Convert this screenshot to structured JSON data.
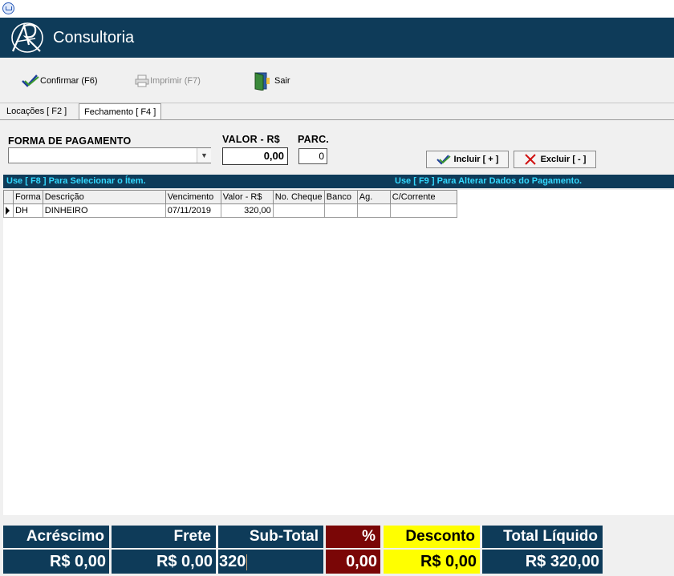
{
  "brand": {
    "name": "Consultoria"
  },
  "toolbar": {
    "confirm_label": "Confirmar (F6)",
    "print_label": "Imprimir  (F7)",
    "exit_label": "Sair"
  },
  "tabs": [
    {
      "label": "Locações [ F2 ]"
    },
    {
      "label": "Fechamento [ F4 ]"
    }
  ],
  "form": {
    "forma_label": "FORMA DE PAGAMENTO",
    "forma_value": "",
    "valor_label": "VALOR - R$",
    "valor_value": "0,00",
    "parc_label": "PARC.",
    "parc_value": "0",
    "incluir_label": "Incluir [ + ]",
    "excluir_label": "Excluir [ - ]"
  },
  "hints": {
    "left": "Use [ F8 ] Para Selecionar o Ítem.",
    "right": "Use [ F9 ] Para Alterar Dados do Pagamento."
  },
  "grid": {
    "columns": [
      "Forma",
      "Descrição",
      "Vencimento",
      "Valor - R$",
      "No. Cheque",
      "Banco",
      "Ag.",
      "C/Corrente"
    ],
    "rows": [
      {
        "forma": "DH",
        "descricao": "DINHEIRO",
        "vencimento": "07/11/2019",
        "valor": "320,00",
        "cheque": "",
        "banco": "",
        "ag": "",
        "cc": ""
      }
    ]
  },
  "totals": {
    "acrescimo_label": "Acréscimo",
    "acrescimo_value": "R$ 0,00",
    "frete_label": "Frete",
    "frete_value": "R$ 0,00",
    "subtotal_label": "Sub-Total",
    "subtotal_value": "320",
    "pct_label": "%",
    "pct_value": "0,00",
    "desconto_label": "Desconto",
    "desconto_value": "R$ 0,00",
    "liquido_label": "Total Líquido",
    "liquido_value": "R$ 320,00"
  },
  "colors": {
    "navy": "#0e3b59",
    "maroon": "#7a0606",
    "yellow": "#ffff00",
    "hint": "#33d9ff"
  }
}
